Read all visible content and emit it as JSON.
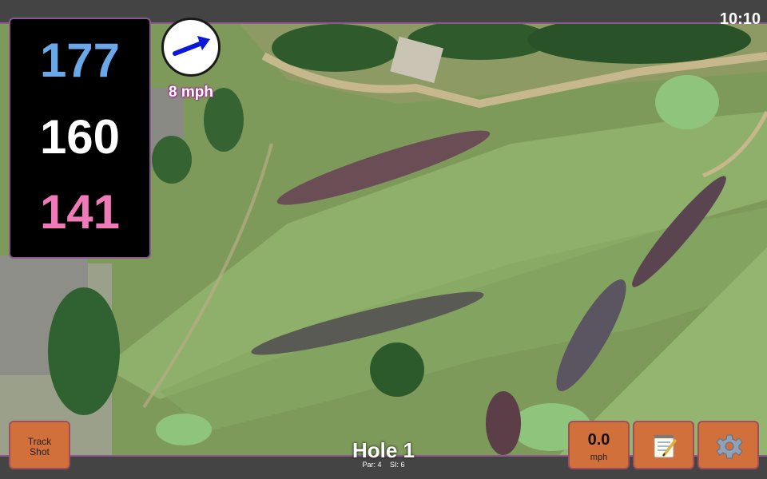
{
  "status": {
    "time": "10:10"
  },
  "yardages": {
    "back": "177",
    "middle": "160",
    "front": "141"
  },
  "wind": {
    "speed_label": "8 mph",
    "icon": "wind-direction-arrow-icon"
  },
  "buttons": {
    "track_shot": {
      "line1": "Track",
      "line2": "Shot"
    },
    "speed": {
      "value": "0.0",
      "unit": "mph"
    },
    "notes": {
      "icon": "notepad-icon"
    },
    "settings": {
      "icon": "gear-icon"
    }
  },
  "hole": {
    "title": "Hole 1",
    "par": "Par: 4",
    "si": "SI: 6"
  },
  "colors": {
    "back": "#6ba8ea",
    "middle": "#ffffff",
    "front": "#f07ab8",
    "button": "#d2703c"
  }
}
